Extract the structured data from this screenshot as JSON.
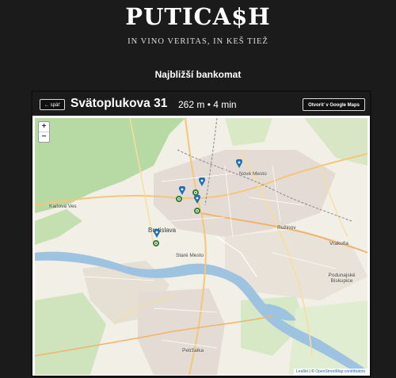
{
  "brand": {
    "title": "PUTICA$H",
    "tagline": "IN VINO VERITAS, IN KEŠ TIEŽ"
  },
  "heading": "Najbližší bankomat",
  "card": {
    "back_label": "← späť",
    "atm_name": "Svätoplukova 31",
    "distance": "262 m",
    "separator": "•",
    "duration": "4 min",
    "open_maps_label": "Otvoriť v Google Maps"
  },
  "map": {
    "zoom_in": "+",
    "zoom_out": "−",
    "attribution": {
      "leaflet": "Leaflet",
      "sep": " | © ",
      "osm": "OpenStreetMap contributors"
    },
    "labels": {
      "bratislava": "Bratislava",
      "stare_mesto": "Staré Mesto",
      "nove_mesto": "Nové Mesto",
      "ruzinov": "Ružinov",
      "karlova_ves": "Karlova Ves",
      "vrakuna": "Vrakuňa",
      "podunajske": "Podunajské Biskupice",
      "petrzalka": "Petržalka"
    },
    "colors": {
      "atm_pin": "#1f6fb5",
      "user_location": "#2e7d32",
      "river": "#8fb8d8"
    }
  }
}
